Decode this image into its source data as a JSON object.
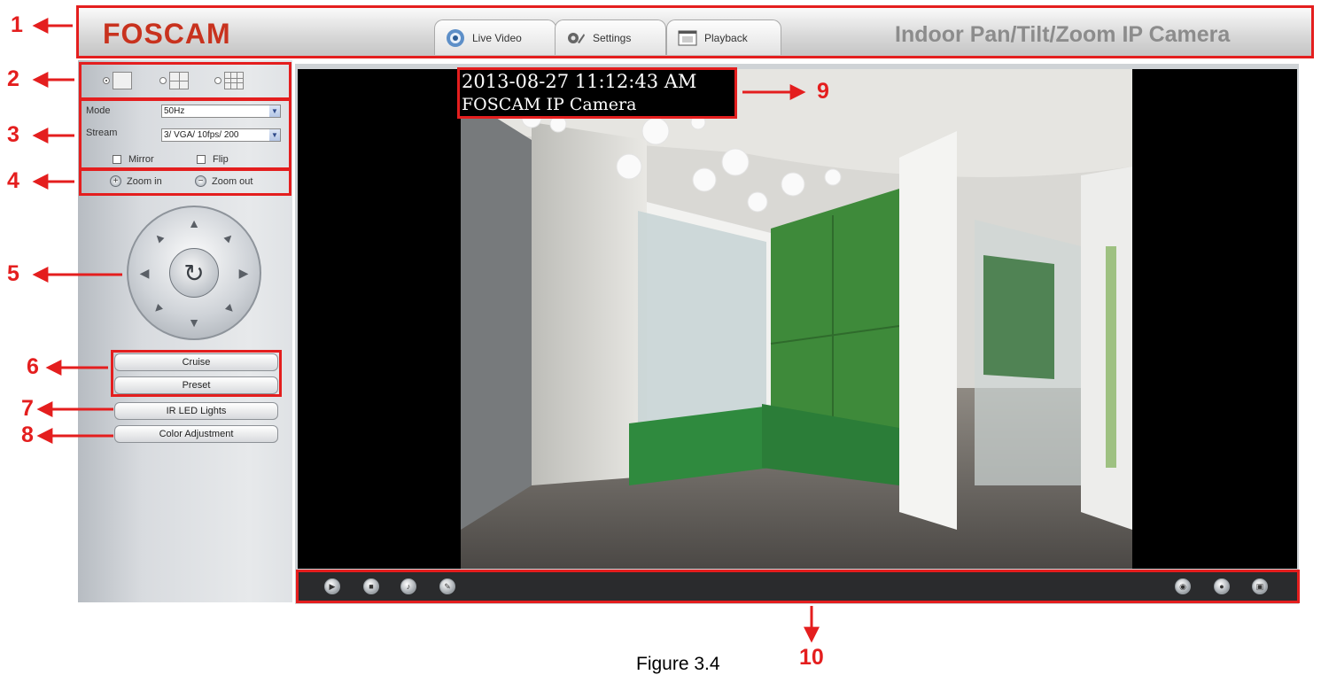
{
  "header": {
    "logo": "FOSCAM",
    "tabs": [
      {
        "label": "Live Video",
        "icon": "camera-icon"
      },
      {
        "label": "Settings",
        "icon": "wrench-gear-icon"
      },
      {
        "label": "Playback",
        "icon": "film-icon"
      }
    ],
    "product_title": "Indoor Pan/Tilt/Zoom IP Camera"
  },
  "left_panel": {
    "layouts": [
      "single-view",
      "four-view",
      "nine-view"
    ],
    "mode_label": "Mode",
    "mode_value": "50Hz",
    "stream_label": "Stream",
    "stream_value": "3/ VGA/ 10fps/ 200",
    "mirror_label": "Mirror",
    "flip_label": "Flip",
    "zoom_in_label": "Zoom in",
    "zoom_out_label": "Zoom out",
    "cruise_label": "Cruise",
    "preset_label": "Preset",
    "ir_label": "IR LED Lights",
    "color_label": "Color Adjustment"
  },
  "video": {
    "osd_time": "2013-08-27 11:12:43 AM",
    "osd_name": "FOSCAM IP Camera",
    "toolbar_left": [
      "play-icon",
      "stop-icon",
      "audio-icon",
      "talk-icon"
    ],
    "toolbar_right": [
      "snapshot-icon",
      "record-icon",
      "fullscreen-icon"
    ]
  },
  "annotations": [
    "1",
    "2",
    "3",
    "4",
    "5",
    "6",
    "7",
    "8",
    "9",
    "10"
  ],
  "caption": "Figure 3.4",
  "colors": {
    "annotation": "#e41e1e",
    "logo": "#c8321e",
    "toolbar": "#2a2b2d"
  }
}
